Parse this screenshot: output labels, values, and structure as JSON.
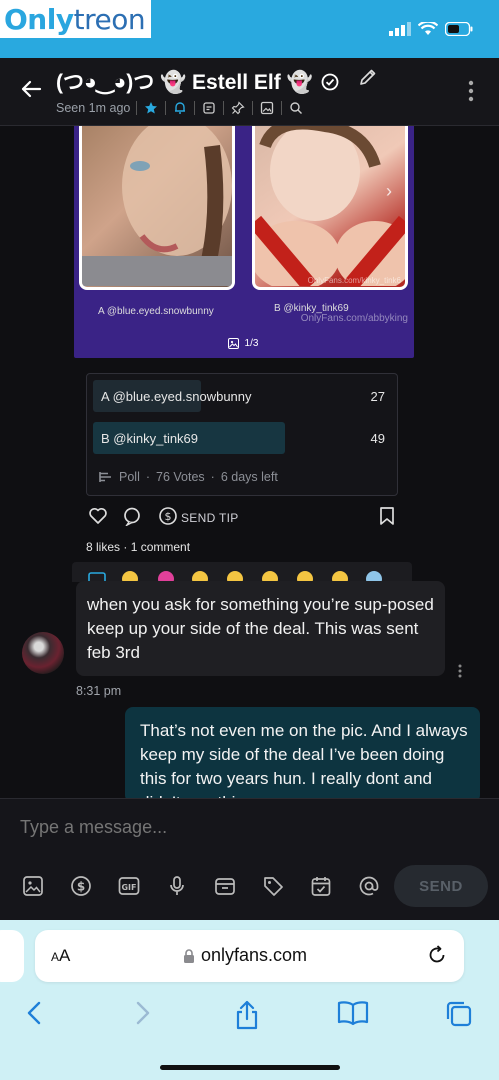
{
  "watermark": {
    "part1": "Only",
    "part2": "treon"
  },
  "header": {
    "title": "(つ◕‿◕)つ 👻 Estell Elf 👻",
    "seen": "Seen 1m ago",
    "icons": [
      "back-arrow-icon",
      "verified-icon",
      "pencil-icon",
      "star-icon",
      "bell-icon",
      "note-icon",
      "pin-icon",
      "image-icon",
      "search-icon",
      "more-icon"
    ]
  },
  "post": {
    "candidate_a_label": "A @blue.eyed.snowbunny",
    "candidate_b_label": "B @kinky_tink69",
    "overlay_b": "OnlyFans.com/kinky_tink6",
    "overlay_post": "OnlyFans.com/abbyking",
    "counter": "1/3"
  },
  "poll": {
    "options": [
      {
        "label": "A @blue.eyed.snowbunny",
        "votes": "27",
        "share": 0.36
      },
      {
        "label": "B @kinky_tink69",
        "votes": "49",
        "share": 0.64
      }
    ],
    "type": "Poll",
    "votes_total": "76 Votes",
    "time_left": "6 days left"
  },
  "actions": {
    "send_tip": "SEND TIP",
    "likes": "8 likes",
    "comments": "1 comment"
  },
  "messages": {
    "incoming": {
      "text": "when you ask for something you’re sup-posed keep up your side of the deal. This was sent feb 3rd",
      "time": "8:31 pm"
    },
    "outgoing": {
      "text": "That’s not even me on the pic. And I always keep my side of the deal I’ve been doing this for two years hun. I really dont and didn’t use this"
    }
  },
  "composer": {
    "placeholder": "Type a message...",
    "send_label": "SEND",
    "tools": [
      "image-icon",
      "dollar-icon",
      "gif-icon",
      "microphone-icon",
      "vault-icon",
      "price-tag-icon",
      "calendar-check-icon",
      "mention-icon"
    ]
  },
  "browser": {
    "aa": "AA",
    "url": "onlyfans.com"
  },
  "colors": {
    "accent": "#29a9df",
    "poll_purple": "#3a2386",
    "outgoing_bubble": "#0d3440"
  }
}
